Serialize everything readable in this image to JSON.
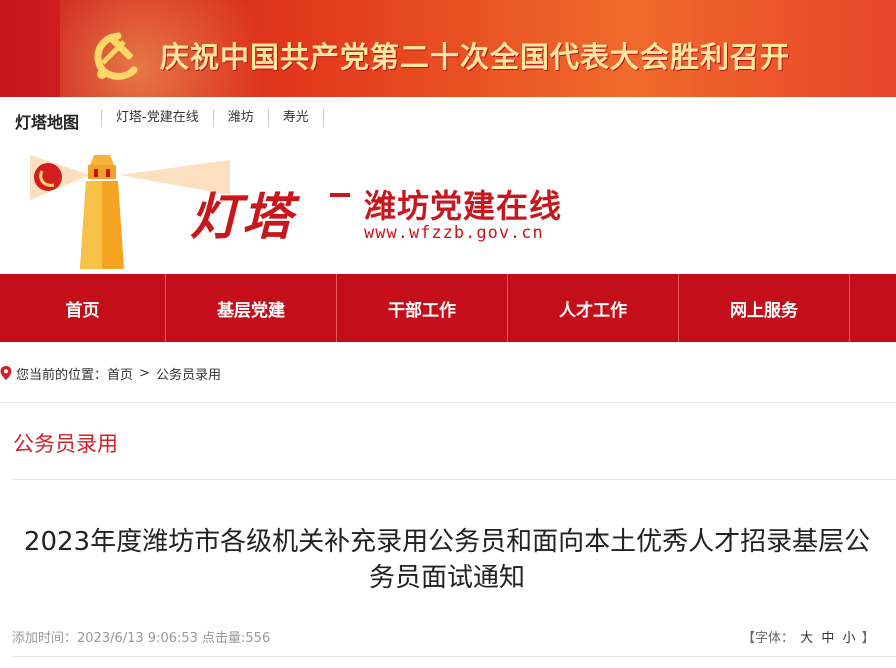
{
  "banner": {
    "slogan": "庆祝中国共产党第二十次全国代表大会胜利召开",
    "colors": {
      "primary": "#c8161d",
      "slogan": "#fde7a0"
    }
  },
  "sitebar": {
    "sitemap": "灯塔地图",
    "links": [
      "灯塔-党建在线",
      "潍坊",
      "寿光"
    ]
  },
  "logo": {
    "brand": "灯塔",
    "site_name": "潍坊党建在线",
    "url": "www.wfzzb.gov.cn"
  },
  "nav": {
    "items": [
      "首页",
      "基层党建",
      "干部工作",
      "人才工作",
      "网上服务"
    ],
    "color": "#c40f1a"
  },
  "breadcrumb": {
    "prefix": "您当前的位置：",
    "home": "首页",
    "sep": ">",
    "current": "公务员录用"
  },
  "section": {
    "title": "公务员录用"
  },
  "article": {
    "title": "2023年度潍坊市各级机关补充录用公务员和面向本土优秀人才招录基层公务员面试通知",
    "meta": "添加时间：2023/6/13 9:06:53 点击量:556",
    "font_label": "【字体：",
    "font_sizes": [
      "大",
      "中",
      "小"
    ],
    "font_close": "】"
  }
}
